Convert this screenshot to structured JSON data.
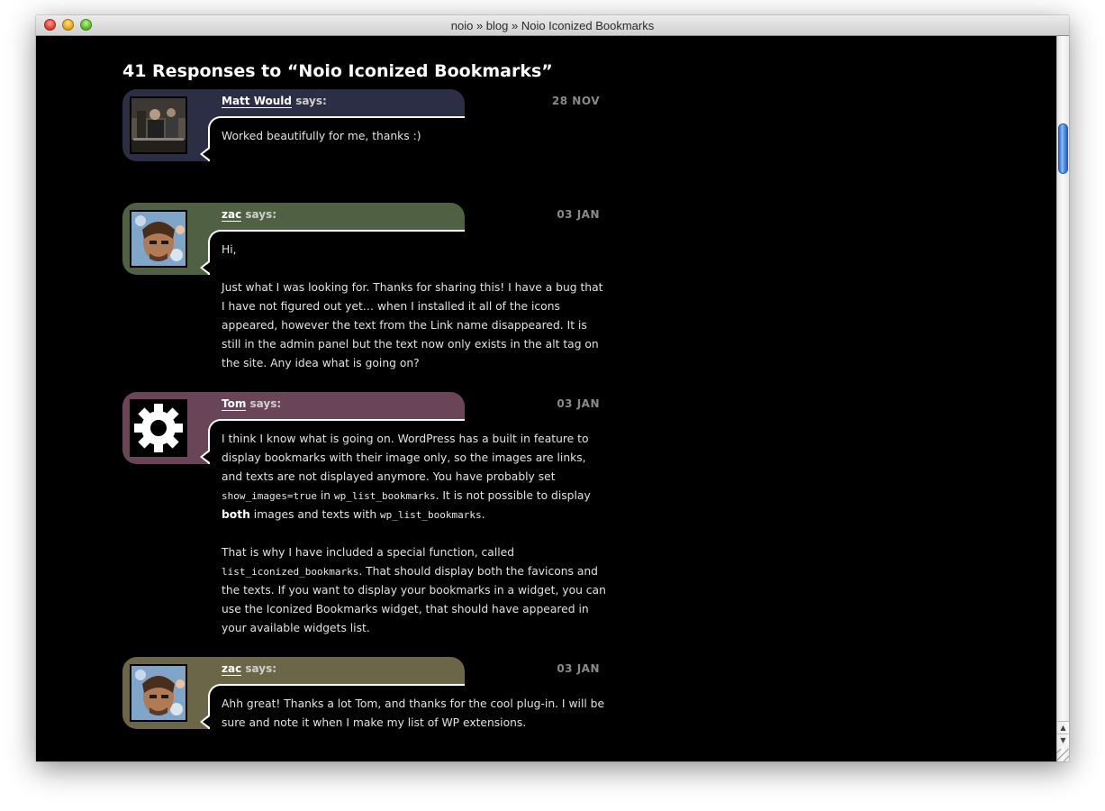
{
  "window": {
    "title": "noio » blog » Noio Iconized Bookmarks"
  },
  "heading": "41 Responses to “Noio Iconized Bookmarks”",
  "says_label": "says:",
  "comments": [
    {
      "author": "Matt Would",
      "date": "28 NOV",
      "bubble_color": "#2c2e45",
      "avatar_icon": "photo-avatar",
      "paragraphs": [
        "Worked beautifully for me, thanks :)"
      ]
    },
    {
      "author": "zac",
      "date": "03 JAN",
      "bubble_color": "#4f6043",
      "avatar_icon": "photo-avatar",
      "paragraphs": [
        "Hi,",
        "Just what I was looking for. Thanks for sharing this! I have a bug that I have not figured out yet… when I installed it all of the icons appeared, however the text from the Link name disappeared. It is still in the admin panel but the text now only exists in the alt tag on the site. Any idea what is going on?"
      ]
    },
    {
      "author": "Tom",
      "date": "03 JAN",
      "bubble_color": "#6a4558",
      "avatar_icon": "gear-icon",
      "p1_a": "I think I know what is going on. WordPress has a built in feature to display bookmarks with their image only, so the images are links, and texts are not displayed anymore. You have probably set ",
      "p1_code1": "show_images=true",
      "p1_b": " in ",
      "p1_code2": "wp_list_bookmarks",
      "p1_c": ". It is not possible to display ",
      "p1_bold": "both",
      "p1_d": " images and texts with ",
      "p1_code3": "wp_list_bookmarks",
      "p1_e": ".",
      "p2_a": "That is why I have included a special function, called ",
      "p2_code": "list_iconized_bookmarks",
      "p2_b": ". That should display both the favicons and the texts. If you want to display your bookmarks in a widget, you can use the Iconized Bookmarks widget, that should have appeared in your available widgets list."
    },
    {
      "author": "zac",
      "date": "03 JAN",
      "bubble_color": "#6b6648",
      "avatar_icon": "photo-avatar",
      "paragraphs": [
        "Ahh great! Thanks a lot Tom, and thanks for the cool plug-in. I will be sure and note it when I make my list of WP extensions."
      ]
    }
  ],
  "scrollbar": {
    "up_arrow": "▲",
    "down_arrow": "▼"
  }
}
